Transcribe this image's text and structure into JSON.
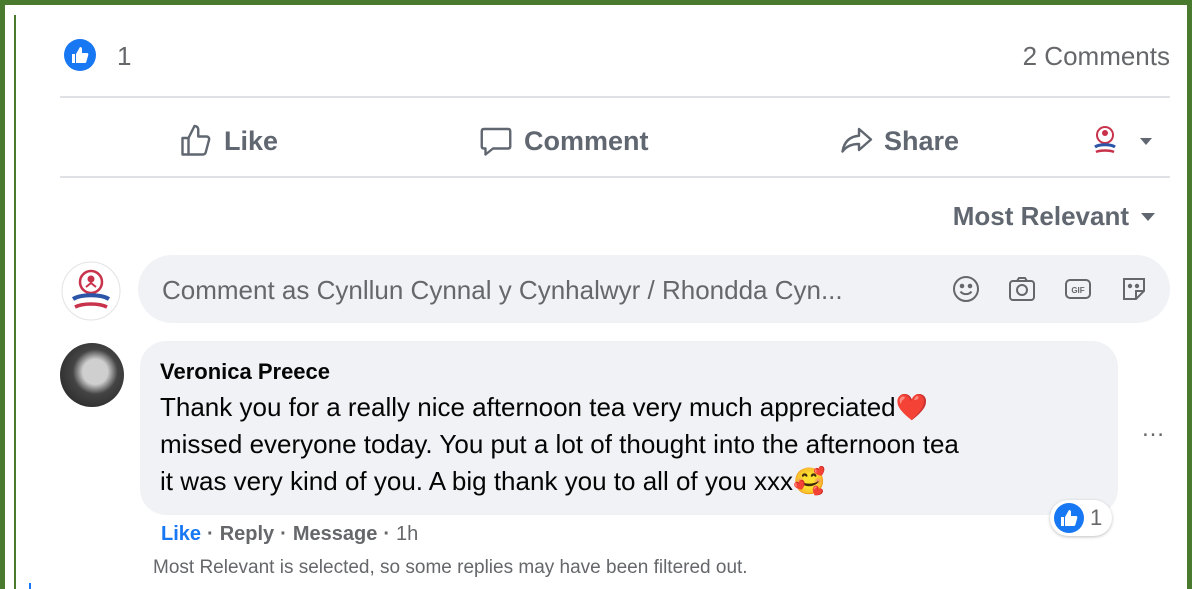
{
  "post_stats": {
    "like_count": "1",
    "comments_count": "2 Comments"
  },
  "actions": {
    "like_label": "Like",
    "comment_label": "Comment",
    "share_label": "Share"
  },
  "sort": {
    "label": "Most Relevant"
  },
  "composer": {
    "placeholder": "Comment as Cynllun Cynnal y Cynhalwyr / Rhondda Cyn..."
  },
  "comment": {
    "author": "Veronica Preece",
    "lines": [
      "Thank you for a really nice afternoon tea very much appreciated❤️",
      "missed everyone today. You put a lot of thought into the afternoon tea",
      "it was very kind of you. A big thank you to all of you xxx🥰"
    ],
    "reaction_count": "1",
    "actions": {
      "like": "Like",
      "reply": "Reply",
      "message": "Message",
      "separator": "·",
      "time": "1h"
    },
    "more_label": "…"
  },
  "filter_note": "Most Relevant is selected, so some replies may have been filtered out.",
  "colors": {
    "frame_border": "#4a7a2e",
    "facebook_blue": "#1877f2",
    "secondary_text": "#65676b",
    "bubble_bg": "#f0f2f5",
    "heart_red": "#e0314b"
  }
}
